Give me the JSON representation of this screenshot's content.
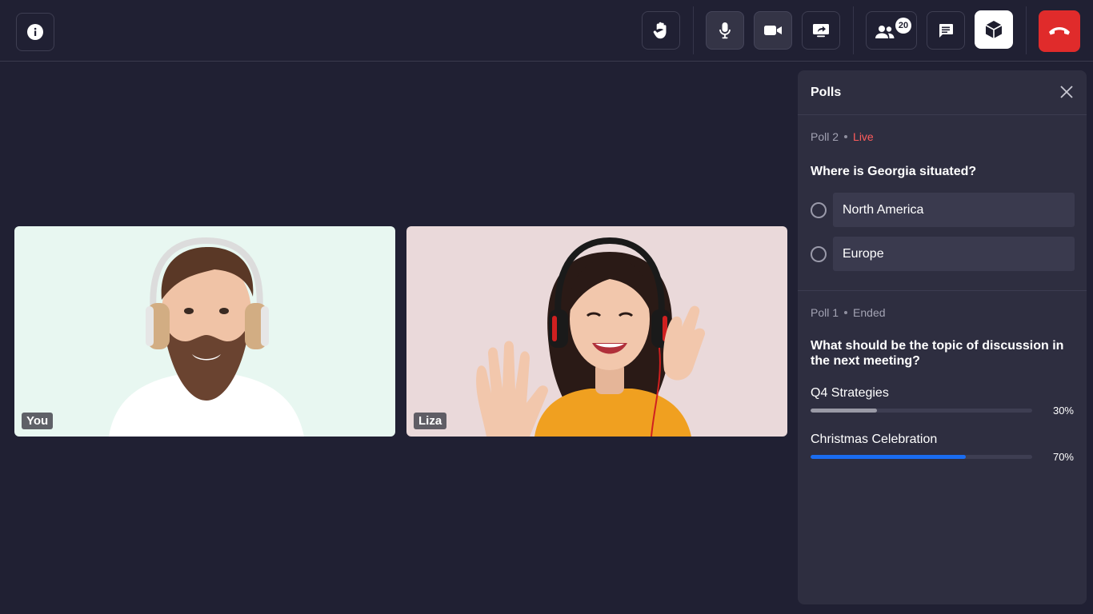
{
  "toolbar": {
    "buttons": [
      {
        "name": "info",
        "icon": "info-icon"
      },
      {
        "name": "raise-hand",
        "icon": "hand-icon"
      },
      {
        "name": "microphone",
        "icon": "microphone-icon"
      },
      {
        "name": "camera",
        "icon": "video-camera-icon"
      },
      {
        "name": "share-screen",
        "icon": "screen-share-icon"
      },
      {
        "name": "participants",
        "icon": "people-icon",
        "badge": "20"
      },
      {
        "name": "chat",
        "icon": "chat-icon"
      },
      {
        "name": "polls",
        "icon": "cube-icon"
      },
      {
        "name": "leave-call",
        "icon": "phone-hangup-icon"
      }
    ]
  },
  "videos": [
    {
      "label": "You",
      "background": "#e8f7f1"
    },
    {
      "label": "Liza",
      "background": "#ead9da"
    }
  ],
  "polls_panel": {
    "title": "Polls",
    "polls": [
      {
        "name": "Poll 2",
        "status": "Live",
        "question": "Where is Georgia situated?",
        "options": [
          "North America",
          "Europe"
        ]
      },
      {
        "name": "Poll 1",
        "status": "Ended",
        "question": "What should be the topic of discussion in the next meeting?",
        "results": [
          {
            "label": "Q4 Strategies",
            "percent": 30,
            "percent_text": "30%",
            "color": "#9a9aa6"
          },
          {
            "label": "Christmas Celebration",
            "percent": 70,
            "percent_text": "70%",
            "color": "#1a6cf0"
          }
        ]
      }
    ]
  },
  "colors": {
    "background": "#202033",
    "panel": "#2e2e40",
    "live": "#ff5c5c",
    "leave": "#e02b2b"
  }
}
